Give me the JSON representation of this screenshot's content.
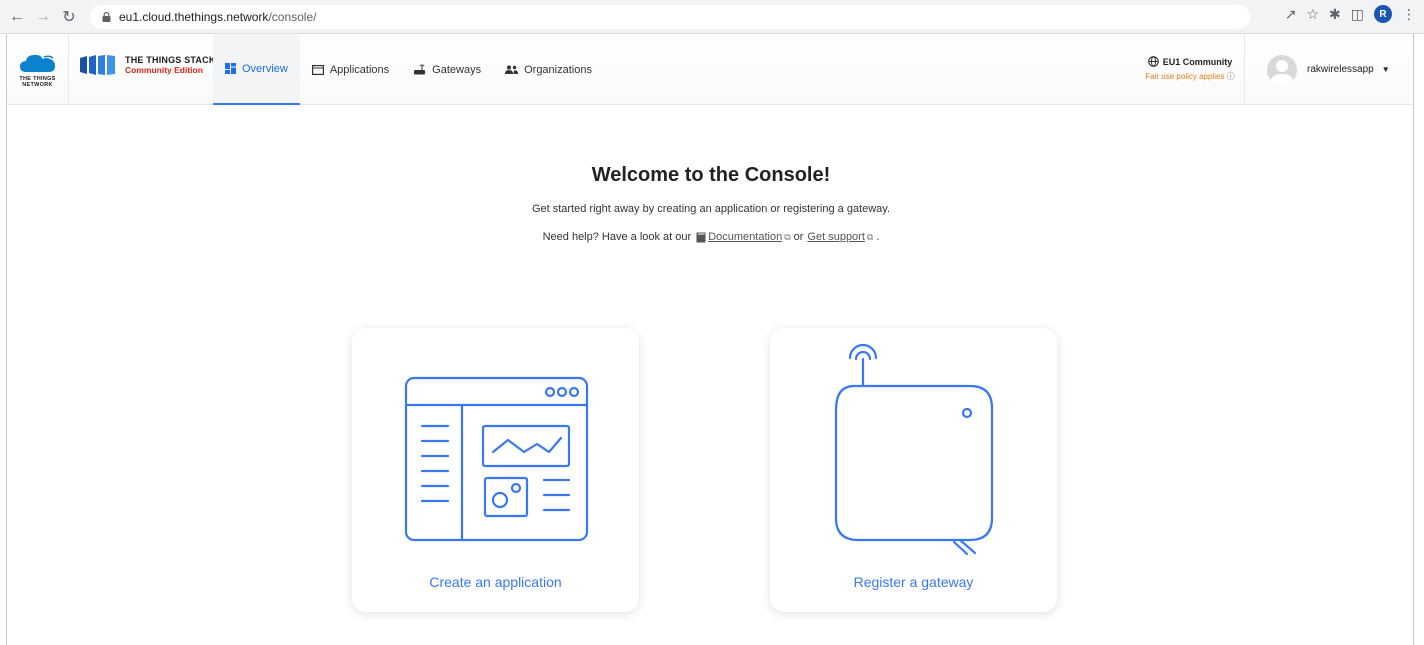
{
  "browser": {
    "url_host": "eu1.cloud.thethings.network",
    "url_path": "/console/",
    "profile_initial": "R"
  },
  "brand": {
    "ttn_line1": "THE THINGS",
    "ttn_line2": "NETWORK",
    "stack_title": "THE THINGS STACK",
    "stack_edition": "Community Edition",
    "accent": "#3a78f0",
    "edition_color": "#e2231a"
  },
  "nav": {
    "items": [
      {
        "label": "Overview",
        "icon": "overview-icon",
        "active": true
      },
      {
        "label": "Applications",
        "icon": "application-icon",
        "active": false
      },
      {
        "label": "Gateways",
        "icon": "gateway-icon",
        "active": false
      },
      {
        "label": "Organizations",
        "icon": "organizations-icon",
        "active": false
      }
    ]
  },
  "cluster": {
    "name": "EU1 Community",
    "note": "Fair use policy applies"
  },
  "user": {
    "name": "rakwirelessapp"
  },
  "welcome": {
    "title": "Welcome to the Console!",
    "subtitle": "Get started right away by creating an application or registering a gateway.",
    "help_prefix": "Need help? Have a look at our",
    "doc_link": "Documentation",
    "or_text": "or",
    "support_link": "Get support",
    "end_punct": "."
  },
  "cards": {
    "create_app": "Create an application",
    "register_gateway": "Register a gateway"
  }
}
